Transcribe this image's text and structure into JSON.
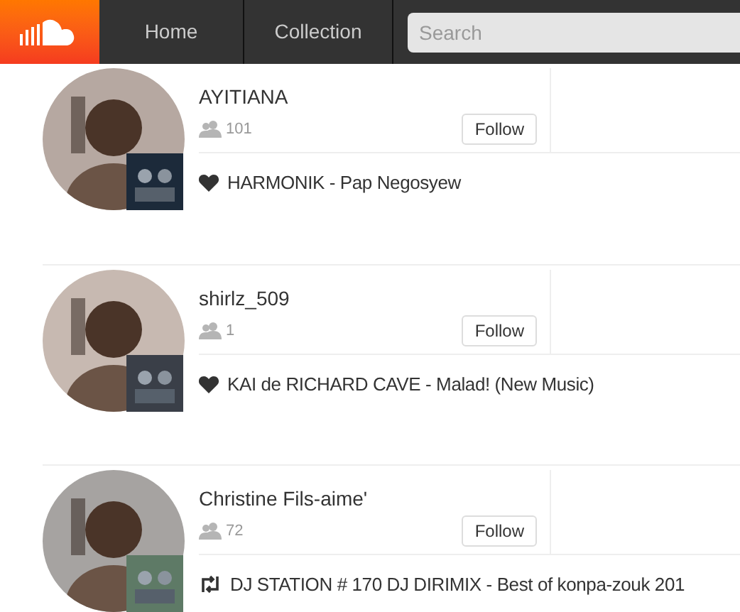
{
  "nav": {
    "tabs": [
      {
        "label": "Home",
        "selected": false
      },
      {
        "label": "Collection",
        "selected": false
      }
    ],
    "search": {
      "placeholder": "Search"
    }
  },
  "entries": [
    {
      "name": "AYITIANA",
      "followers": "101",
      "follow_label": "Follow",
      "activity": {
        "kind": "like",
        "text": "HARMONIK - Pap Negosyew"
      }
    },
    {
      "name": "shirlz_509",
      "followers": "1",
      "follow_label": "Follow",
      "activity": {
        "kind": "like",
        "text": "KAI de RICHARD CAVE - Malad! (New Music)"
      }
    },
    {
      "name": "Christine Fils-aime'",
      "followers": "72",
      "follow_label": "Follow",
      "activity": {
        "kind": "repost",
        "text": "DJ STATION # 170 DJ DIRIMIX - Best of konpa-zouk 201"
      }
    }
  ]
}
